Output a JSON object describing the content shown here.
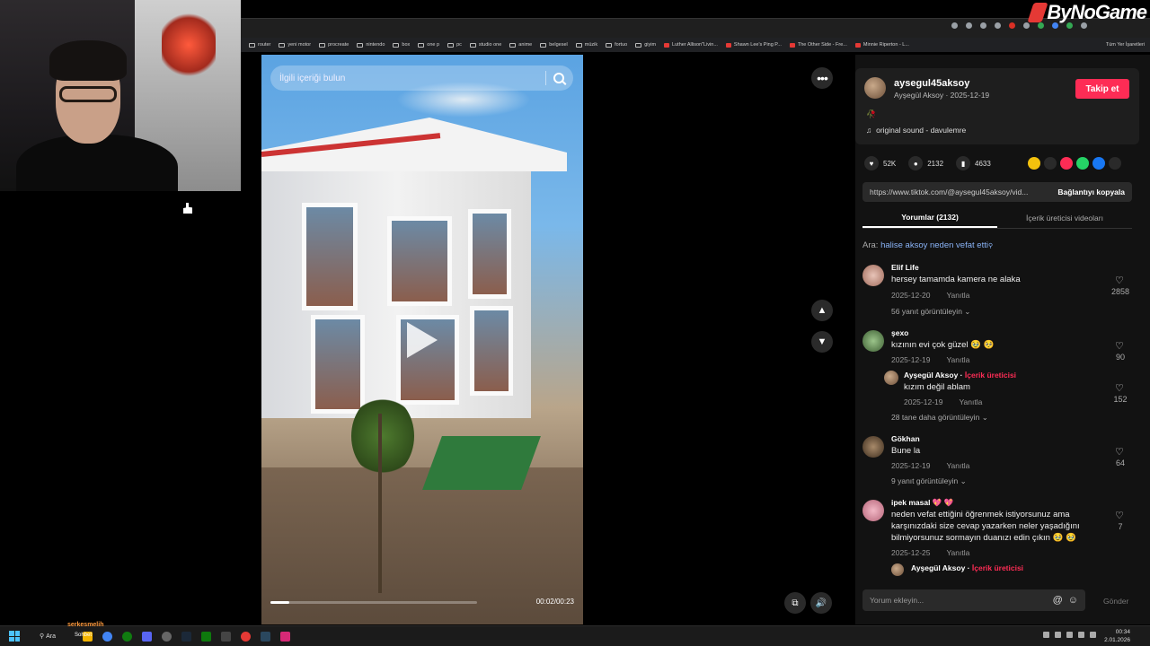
{
  "logo": {
    "text": "ByNoGame"
  },
  "bookmarks": [
    {
      "label": "router",
      "type": "z"
    },
    {
      "label": "yeni motor",
      "type": "folder"
    },
    {
      "label": "procreate",
      "type": "folder"
    },
    {
      "label": "nintendo",
      "type": "folder"
    },
    {
      "label": "box",
      "type": "folder"
    },
    {
      "label": "one p",
      "type": "folder"
    },
    {
      "label": "pc",
      "type": "folder"
    },
    {
      "label": "studio one",
      "type": "folder"
    },
    {
      "label": "anime",
      "type": "folder"
    },
    {
      "label": "belgesel",
      "type": "folder"
    },
    {
      "label": "müzik",
      "type": "folder"
    },
    {
      "label": "fortuo",
      "type": "folder"
    },
    {
      "label": "giyim",
      "type": "folder"
    },
    {
      "label": "Luther Allison\"Livin...",
      "type": "yt"
    },
    {
      "label": "Shawn Lee's Ping P...",
      "type": "yt"
    },
    {
      "label": "The Other Side - Fre...",
      "type": "yt"
    },
    {
      "label": "Minnie Riperton - L...",
      "type": "yt"
    }
  ],
  "bookmarks_all": "Tüm Yer İşaretleri",
  "video": {
    "search_placeholder": "İlgili içeriği bulun",
    "time": "00:02/00:23",
    "progress": 0.09
  },
  "author": {
    "username": "aysegul45aksoy",
    "subline": "Ayşegül Aksoy · 2025-12-19",
    "follow_label": "Takip et",
    "sound": "original sound - davulemre"
  },
  "stats": {
    "likes": "52K",
    "comments": "2132",
    "saves": "4633"
  },
  "link": {
    "url": "https://www.tiktok.com/@aysegul45aksoy/vid...",
    "copy_label": "Bağlantıyı kopyala"
  },
  "tabs": {
    "comments": "Yorumlar (2132)",
    "creator": "İçerik üreticisi videoları"
  },
  "search_suggest": {
    "prefix": "Ara:",
    "query": "halise aksoy neden vefat etti"
  },
  "comments": [
    {
      "name": "Elif Life",
      "text": "hersey tamamda kamera ne alaka",
      "date": "2025-12-20",
      "reply": "Yanıtla",
      "likes": "2858",
      "replies": "56 yanıt görüntüleyin"
    },
    {
      "name": "şexo",
      "text": "kızının evi çok güzel 🥹 🥺",
      "date": "2025-12-19",
      "reply": "Yanıtla",
      "likes": "90"
    },
    {
      "name": "Ayşegül Aksoy",
      "tag": "İçerik üreticisi",
      "text": "kızım değil ablam",
      "date": "2025-12-19",
      "reply": "Yanıtla",
      "likes": "152",
      "replies": "28 tane daha görüntüleyin"
    },
    {
      "name": "Gökhan",
      "text": "Bune la",
      "date": "2025-12-19",
      "reply": "Yanıtla",
      "likes": "64",
      "replies": "9 yanıt görüntüleyin"
    },
    {
      "name": "ipek masal 💖 💖",
      "text": "neden vefat ettiğini öğrenmek istiyorsunuz ama karşınızdaki size cevap yazarken neler yaşadığını bilmiyorsunuz sormayın duanızı edin çıkın 🥹 🥹",
      "date": "2025-12-25",
      "reply": "Yanıtla",
      "likes": "7"
    },
    {
      "name": "Ayşegül Aksoy",
      "tag": "İçerik üreticisi"
    }
  ],
  "comment_input": {
    "placeholder": "Yorum ekleyin...",
    "send_label": "Gönder"
  },
  "taskbar": {
    "search_label": "Ara",
    "overlay_name": "serkesmelih",
    "overlay_sub": "Sohbet",
    "time": "00:34",
    "date": "2.01.2026"
  },
  "colors": {
    "accent": "#fe2c55",
    "link": "#8ab4f8",
    "panel": "#121212"
  }
}
